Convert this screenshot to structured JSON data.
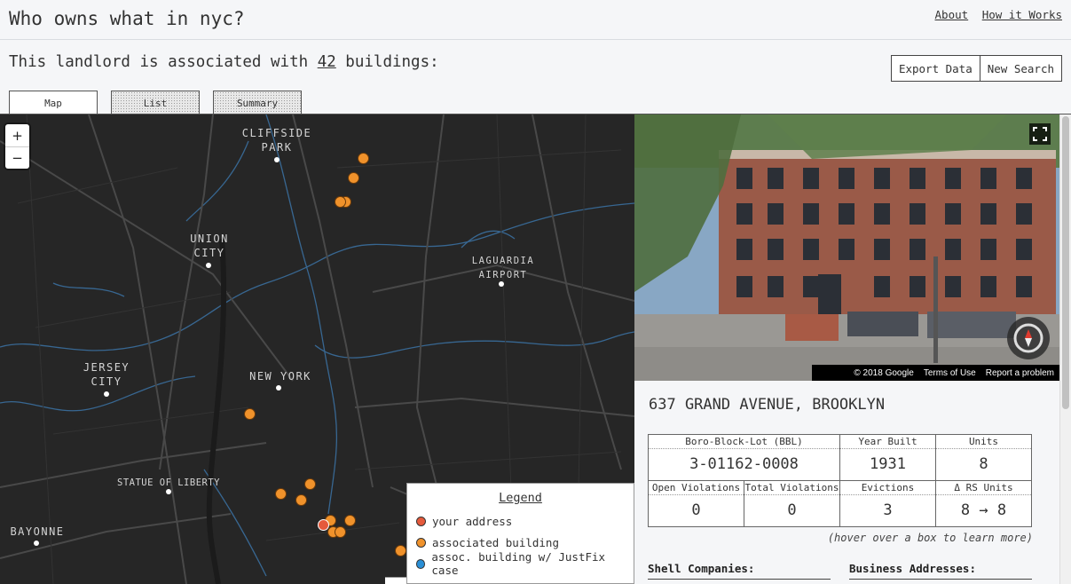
{
  "header": {
    "title": "Who owns what in nyc?",
    "links": [
      "About",
      "How it Works"
    ]
  },
  "summary": {
    "prefix": "This landlord is associated with ",
    "count": "42",
    "suffix": " buildings:"
  },
  "actions": {
    "export": "Export Data",
    "new_search": "New Search"
  },
  "tabs": [
    {
      "label": "Map",
      "active": true
    },
    {
      "label": "List",
      "active": false
    },
    {
      "label": "Summary",
      "active": false
    }
  ],
  "map": {
    "zoom_in": "+",
    "zoom_out": "−",
    "places": {
      "cliffside": [
        "CLIFFSIDE",
        "PARK"
      ],
      "union": [
        "UNION",
        "CITY"
      ],
      "laguardia": [
        "LAGUARDIA",
        "AIRPORT"
      ],
      "jersey": [
        "JERSEY",
        "CITY"
      ],
      "newyork": "NEW YORK",
      "liberty": "STATUE OF LIBERTY",
      "bayonne": "BAYONNE"
    },
    "colors": {
      "your_address": "#e55a3c",
      "associated": "#f0922b",
      "justfix": "#2a8fd6",
      "water_lines": "#3a6f9e"
    },
    "legend": {
      "title": "Legend",
      "items": [
        "your address",
        "associated building",
        "assoc. building w/ JustFix case"
      ]
    }
  },
  "streetview": {
    "copyright": "© 2018 Google",
    "terms": "Terms of Use",
    "report": "Report a problem"
  },
  "detail": {
    "address": "637 GRAND AVENUE, BROOKLYN",
    "stats": {
      "bbl": {
        "label": "Boro-Block-Lot (BBL)",
        "value": "3-01162-0008"
      },
      "year": {
        "label": "Year Built",
        "value": "1931"
      },
      "units": {
        "label": "Units",
        "value": "8"
      },
      "open_viol": {
        "label": "Open Violations",
        "value": "0"
      },
      "total_viol": {
        "label": "Total Violations",
        "value": "0"
      },
      "evictions": {
        "label": "Evictions",
        "value": "3"
      },
      "rs_units": {
        "label": "Δ RS Units",
        "value": "8 → 8"
      }
    },
    "hover_note": "(hover over a box to learn more)",
    "shell_companies": "Shell Companies:",
    "business_addresses": "Business Addresses:"
  }
}
